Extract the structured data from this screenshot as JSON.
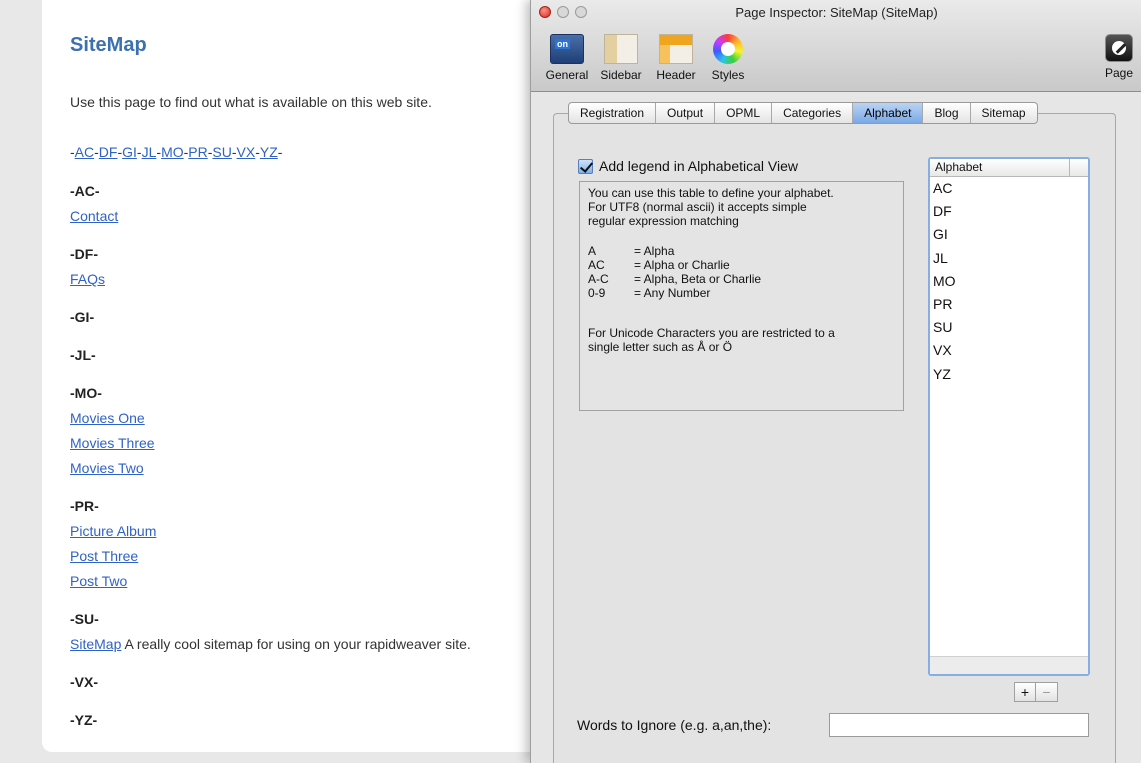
{
  "webpage": {
    "title": "SiteMap",
    "intro": "Use this page to find out what is available on this web site.",
    "alpha_links": [
      "AC",
      "DF",
      "GI",
      "JL",
      "MO",
      "PR",
      "SU",
      "VX",
      "YZ"
    ],
    "sections": [
      {
        "heading": "-AC-",
        "links": [
          {
            "text": "Contact",
            "desc": ""
          }
        ]
      },
      {
        "heading": "-DF-",
        "links": [
          {
            "text": "FAQs",
            "desc": ""
          }
        ]
      },
      {
        "heading": "-GI-",
        "links": []
      },
      {
        "heading": "-JL-",
        "links": []
      },
      {
        "heading": "-MO-",
        "links": [
          {
            "text": "Movies One",
            "desc": ""
          },
          {
            "text": "Movies Three",
            "desc": ""
          },
          {
            "text": "Movies Two",
            "desc": ""
          }
        ]
      },
      {
        "heading": "-PR-",
        "links": [
          {
            "text": "Picture Album",
            "desc": ""
          },
          {
            "text": "Post Three",
            "desc": ""
          },
          {
            "text": "Post Two",
            "desc": ""
          }
        ]
      },
      {
        "heading": "-SU-",
        "links": [
          {
            "text": "SiteMap",
            "desc": " A really cool sitemap for using on your rapidweaver site."
          }
        ]
      },
      {
        "heading": "-VX-",
        "links": []
      },
      {
        "heading": "-YZ-",
        "links": []
      }
    ]
  },
  "inspector": {
    "window_title": "Page Inspector: SiteMap (SiteMap)",
    "toolbar": {
      "general": "General",
      "general_badge": "on",
      "sidebar": "Sidebar",
      "header": "Header",
      "styles": "Styles",
      "page": "Page"
    },
    "tabs": [
      "Registration",
      "Output",
      "OPML",
      "Categories",
      "Alphabet",
      "Blog",
      "Sitemap"
    ],
    "active_tab": "Alphabet",
    "legend_checkbox_label": "Add legend in Alphabetical View",
    "legend_checked": true,
    "help": {
      "line1": "You can use this table to define your alphabet.",
      "line2": "For UTF8 (normal ascii) it accepts simple",
      "line3": "regular expression matching",
      "examples": [
        {
          "key": "A",
          "value": "= Alpha"
        },
        {
          "key": "AC",
          "value": "= Alpha or Charlie"
        },
        {
          "key": "A-C",
          "value": "= Alpha, Beta or Charlie"
        },
        {
          "key": "0-9",
          "value": "= Any Number"
        }
      ],
      "unicode_line1": "For Unicode Characters you are restricted to a",
      "unicode_line2": "single letter such as Å or Ö"
    },
    "alphabet_header": "Alphabet",
    "alphabet_items": [
      "AC",
      "DF",
      "GI",
      "JL",
      "MO",
      "PR",
      "SU",
      "VX",
      "YZ"
    ],
    "add_button": "+",
    "remove_button": "−",
    "ignore_label": "Words to Ignore (e.g. a,an,the):",
    "ignore_value": ""
  },
  "colors": {
    "link": "#2f62c7",
    "title_blue": "#3c71b1",
    "active_tab": "#7aa9e6"
  }
}
